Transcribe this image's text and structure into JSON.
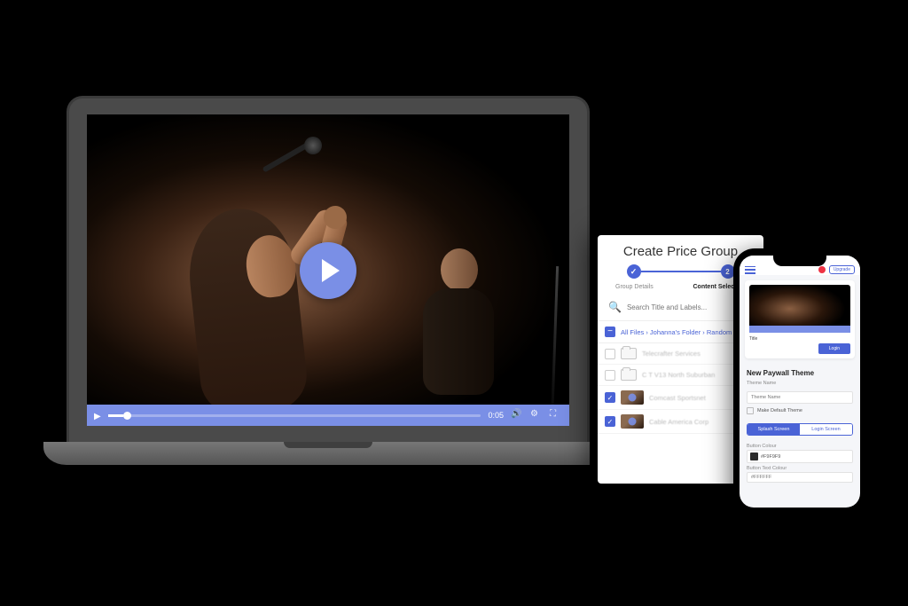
{
  "video": {
    "time_elapsed": "0:05",
    "progress_pct": 4
  },
  "tablet": {
    "title": "Create Price Group",
    "step1_label": "Group Details",
    "step2_label": "Content Selection",
    "search_placeholder": "Search Title and Labels...",
    "breadcrumb_html": "All Files › Johanna's Folder › Random",
    "rows": [
      {
        "checked": false,
        "type": "folder",
        "label": "Telecrafter Services"
      },
      {
        "checked": false,
        "type": "folder",
        "label": "C T V13 North Suburban"
      },
      {
        "checked": true,
        "type": "thumb",
        "label": "Comcast Sportsnet"
      },
      {
        "checked": true,
        "type": "thumb",
        "label": "Cable America Corp"
      }
    ]
  },
  "phone": {
    "upgrade": "Upgrade",
    "preview_title": "Title",
    "login": "Login",
    "section_title": "New Paywall Theme",
    "theme_name_label": "Theme Name",
    "theme_name_value": "Theme Name",
    "default_check": "Make Default Theme",
    "tab_splash": "Splash Screen",
    "tab_login": "Login Screen",
    "button_colour_label": "Button Colour",
    "button_colour_value": "#F9F9F9",
    "button_text_colour_label": "Button Text Colour",
    "button_text_colour_value": "#FFFFFF",
    "colors": {
      "button": "#2b2b2b"
    }
  }
}
